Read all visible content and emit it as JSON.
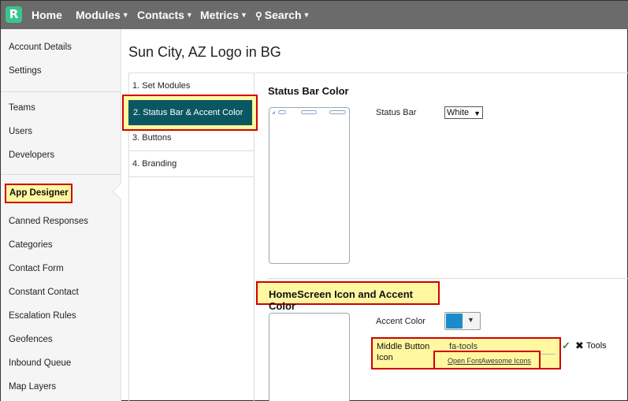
{
  "nav": {
    "logo": "R",
    "items": [
      "Home",
      "Modules",
      "Contacts",
      "Metrics",
      "Search"
    ]
  },
  "sidebar": {
    "items": [
      "Account Details",
      "Settings",
      "Teams",
      "Users",
      "Developers",
      "App Designer",
      "Canned Responses",
      "Categories",
      "Contact Form",
      "Constant Contact",
      "Escalation Rules",
      "Geofences",
      "Inbound Queue",
      "Map Layers"
    ],
    "active": "App Designer"
  },
  "page": {
    "title": "Sun City, AZ Logo in BG"
  },
  "steps": [
    "1. Set Modules",
    "2. Status Bar & Accent Color",
    "3. Buttons",
    "4. Branding"
  ],
  "status_bar": {
    "section_title": "Status Bar Color",
    "label": "Status Bar",
    "value": "White"
  },
  "homescreen": {
    "section_title": "HomeScreen Icon and Accent Color",
    "accent_label": "Accent Color",
    "accent_color": "#1a8ccc",
    "middle_button_label": "Middle Button Icon",
    "middle_button_value": "fa-tools",
    "fa_link": "Open FontAwesome Icons",
    "icon_preview_label": "Tools"
  },
  "colors": {
    "nav_bg": "#6b6b6b",
    "active_step_bg": "#0b5761",
    "highlight": "#fff8a0",
    "highlight_border": "#d00000"
  }
}
